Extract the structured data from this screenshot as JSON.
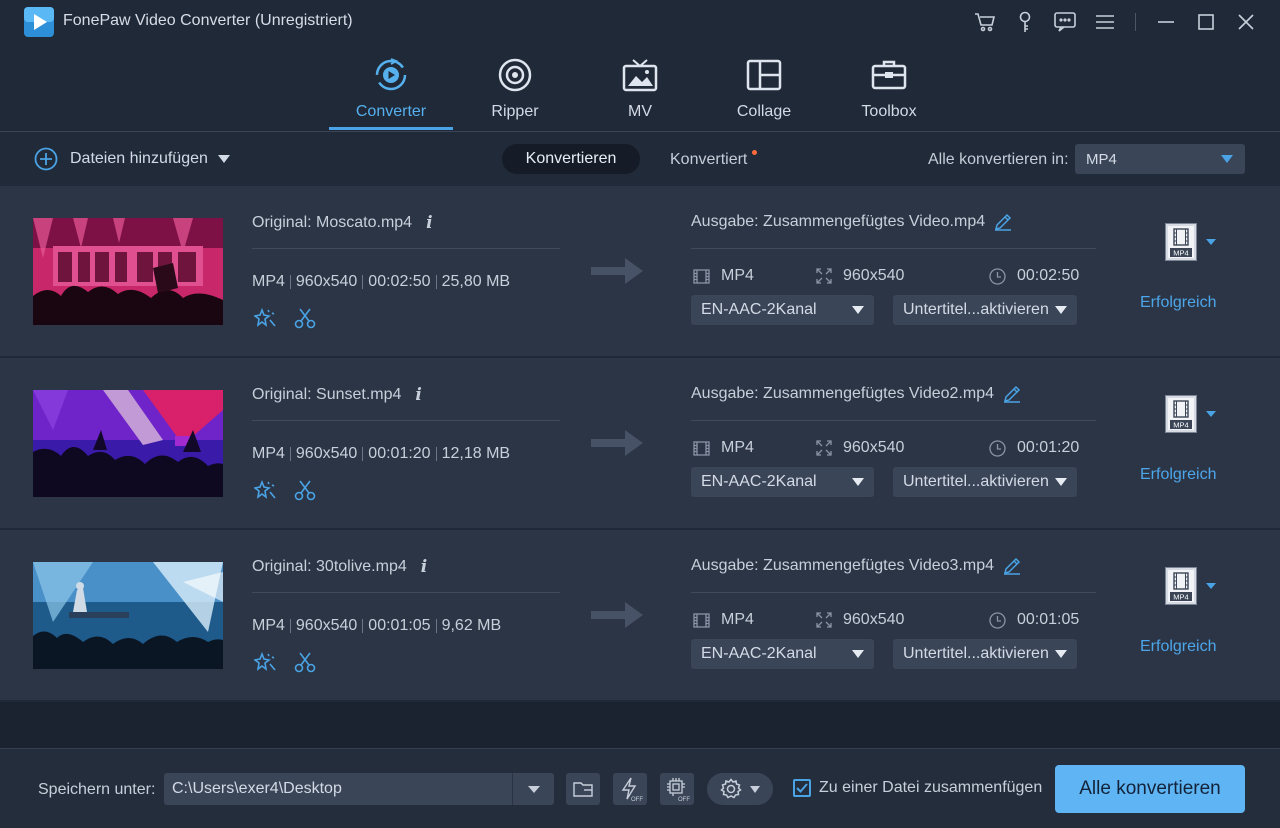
{
  "app": {
    "title": "FonePaw Video Converter (Unregistriert)"
  },
  "nav": {
    "items": [
      {
        "label": "Converter",
        "icon": "converter-icon",
        "active": true
      },
      {
        "label": "Ripper",
        "icon": "disc-icon",
        "active": false
      },
      {
        "label": "MV",
        "icon": "tv-icon",
        "active": false
      },
      {
        "label": "Collage",
        "icon": "collage-icon",
        "active": false
      },
      {
        "label": "Toolbox",
        "icon": "toolbox-icon",
        "active": false
      }
    ]
  },
  "toolbar": {
    "add_files": "Dateien hinzufügen",
    "tab_converting": "Konvertieren",
    "tab_converted": "Konvertiert",
    "convert_all_label": "Alle konvertieren in:",
    "convert_all_format": "MP4"
  },
  "rows": [
    {
      "original": "Original: Moscato.mp4",
      "format": "MP4",
      "resolution": "960x540",
      "duration": "00:02:50",
      "size": "25,80 MB",
      "output": "Ausgabe: Zusammengefügtes Video.mp4",
      "out_format": "MP4",
      "out_resolution": "960x540",
      "out_duration": "00:02:50",
      "audio": "EN-AAC-2Kanal",
      "subtitle": "Untertitel...aktivieren",
      "format_badge": "MP4",
      "status": "Erfolgreich"
    },
    {
      "original": "Original: Sunset.mp4",
      "format": "MP4",
      "resolution": "960x540",
      "duration": "00:01:20",
      "size": "12,18 MB",
      "output": "Ausgabe: Zusammengefügtes Video2.mp4",
      "out_format": "MP4",
      "out_resolution": "960x540",
      "out_duration": "00:01:20",
      "audio": "EN-AAC-2Kanal",
      "subtitle": "Untertitel...aktivieren",
      "format_badge": "MP4",
      "status": "Erfolgreich"
    },
    {
      "original": "Original: 30tolive.mp4",
      "format": "MP4",
      "resolution": "960x540",
      "duration": "00:01:05",
      "size": "9,62 MB",
      "output": "Ausgabe: Zusammengefügtes Video3.mp4",
      "out_format": "MP4",
      "out_resolution": "960x540",
      "out_duration": "00:01:05",
      "audio": "EN-AAC-2Kanal",
      "subtitle": "Untertitel...aktivieren",
      "format_badge": "MP4",
      "status": "Erfolgreich"
    }
  ],
  "bottom": {
    "save_label": "Speichern unter:",
    "path": "C:\\Users\\exer4\\Desktop",
    "merge_label": "Zu einer Datei zusammenfügen",
    "merge_checked": true,
    "convert_button": "Alle konvertieren"
  },
  "colors": {
    "accent": "#4aa3e5",
    "success": "#4ea6ea",
    "background": "#202938",
    "row": "#2b3545"
  }
}
